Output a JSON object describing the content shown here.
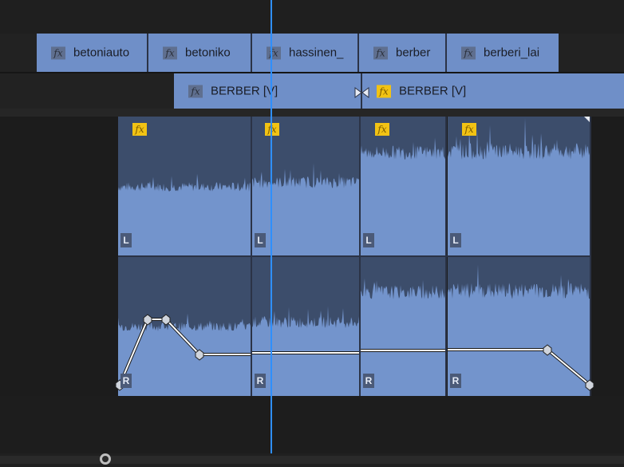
{
  "video_track_1": {
    "clips": [
      {
        "name": "betoniauto",
        "fx": "fx"
      },
      {
        "name": "betoniko",
        "fx": "fx"
      },
      {
        "name": "hassinen_",
        "fx": "fx"
      },
      {
        "name": "berber",
        "fx": "fx"
      },
      {
        "name": "berberi_lai",
        "fx": "fx"
      }
    ]
  },
  "video_track_2": {
    "clips": [
      {
        "name": "BERBER [V]",
        "fx": "fx"
      },
      {
        "name": "BERBER [V]",
        "fx": "fx"
      }
    ]
  },
  "audio_track": {
    "clips": [
      {
        "fx": "fx",
        "left_channel": "L",
        "right_channel": "R"
      },
      {
        "fx": "fx",
        "left_channel": "L",
        "right_channel": "R"
      },
      {
        "fx": "fx",
        "left_channel": "L",
        "right_channel": "R"
      },
      {
        "fx": "fx",
        "left_channel": "L",
        "right_channel": "R"
      }
    ]
  },
  "colors": {
    "clip_fill": "#6f8fc8",
    "waveform_bg": "#3c4d6b",
    "playhead": "#2f8fff",
    "fx_badge_active": "#f2c314",
    "fx_badge_inactive": "#5f6f8f"
  }
}
